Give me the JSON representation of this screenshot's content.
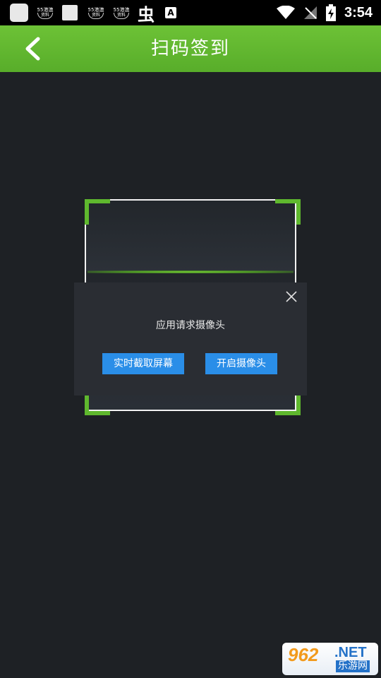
{
  "status_bar": {
    "time": "3:54",
    "app_badge_top": "55港澳",
    "app_badge_bottom": "资料",
    "a_icon_letter": "A",
    "bug_icon_char": "虫"
  },
  "header": {
    "title": "扫码签到",
    "background": "#5fb82e"
  },
  "scanner": {
    "corner_color": "#5fb82e"
  },
  "dialog": {
    "message": "应用请求摄像头",
    "button_capture": "实时截取屏幕",
    "button_camera": "开启摄像头",
    "button_color": "#2a8ee8"
  },
  "watermark": {
    "number": "962",
    "net": ".NET",
    "sub": "乐游网"
  }
}
